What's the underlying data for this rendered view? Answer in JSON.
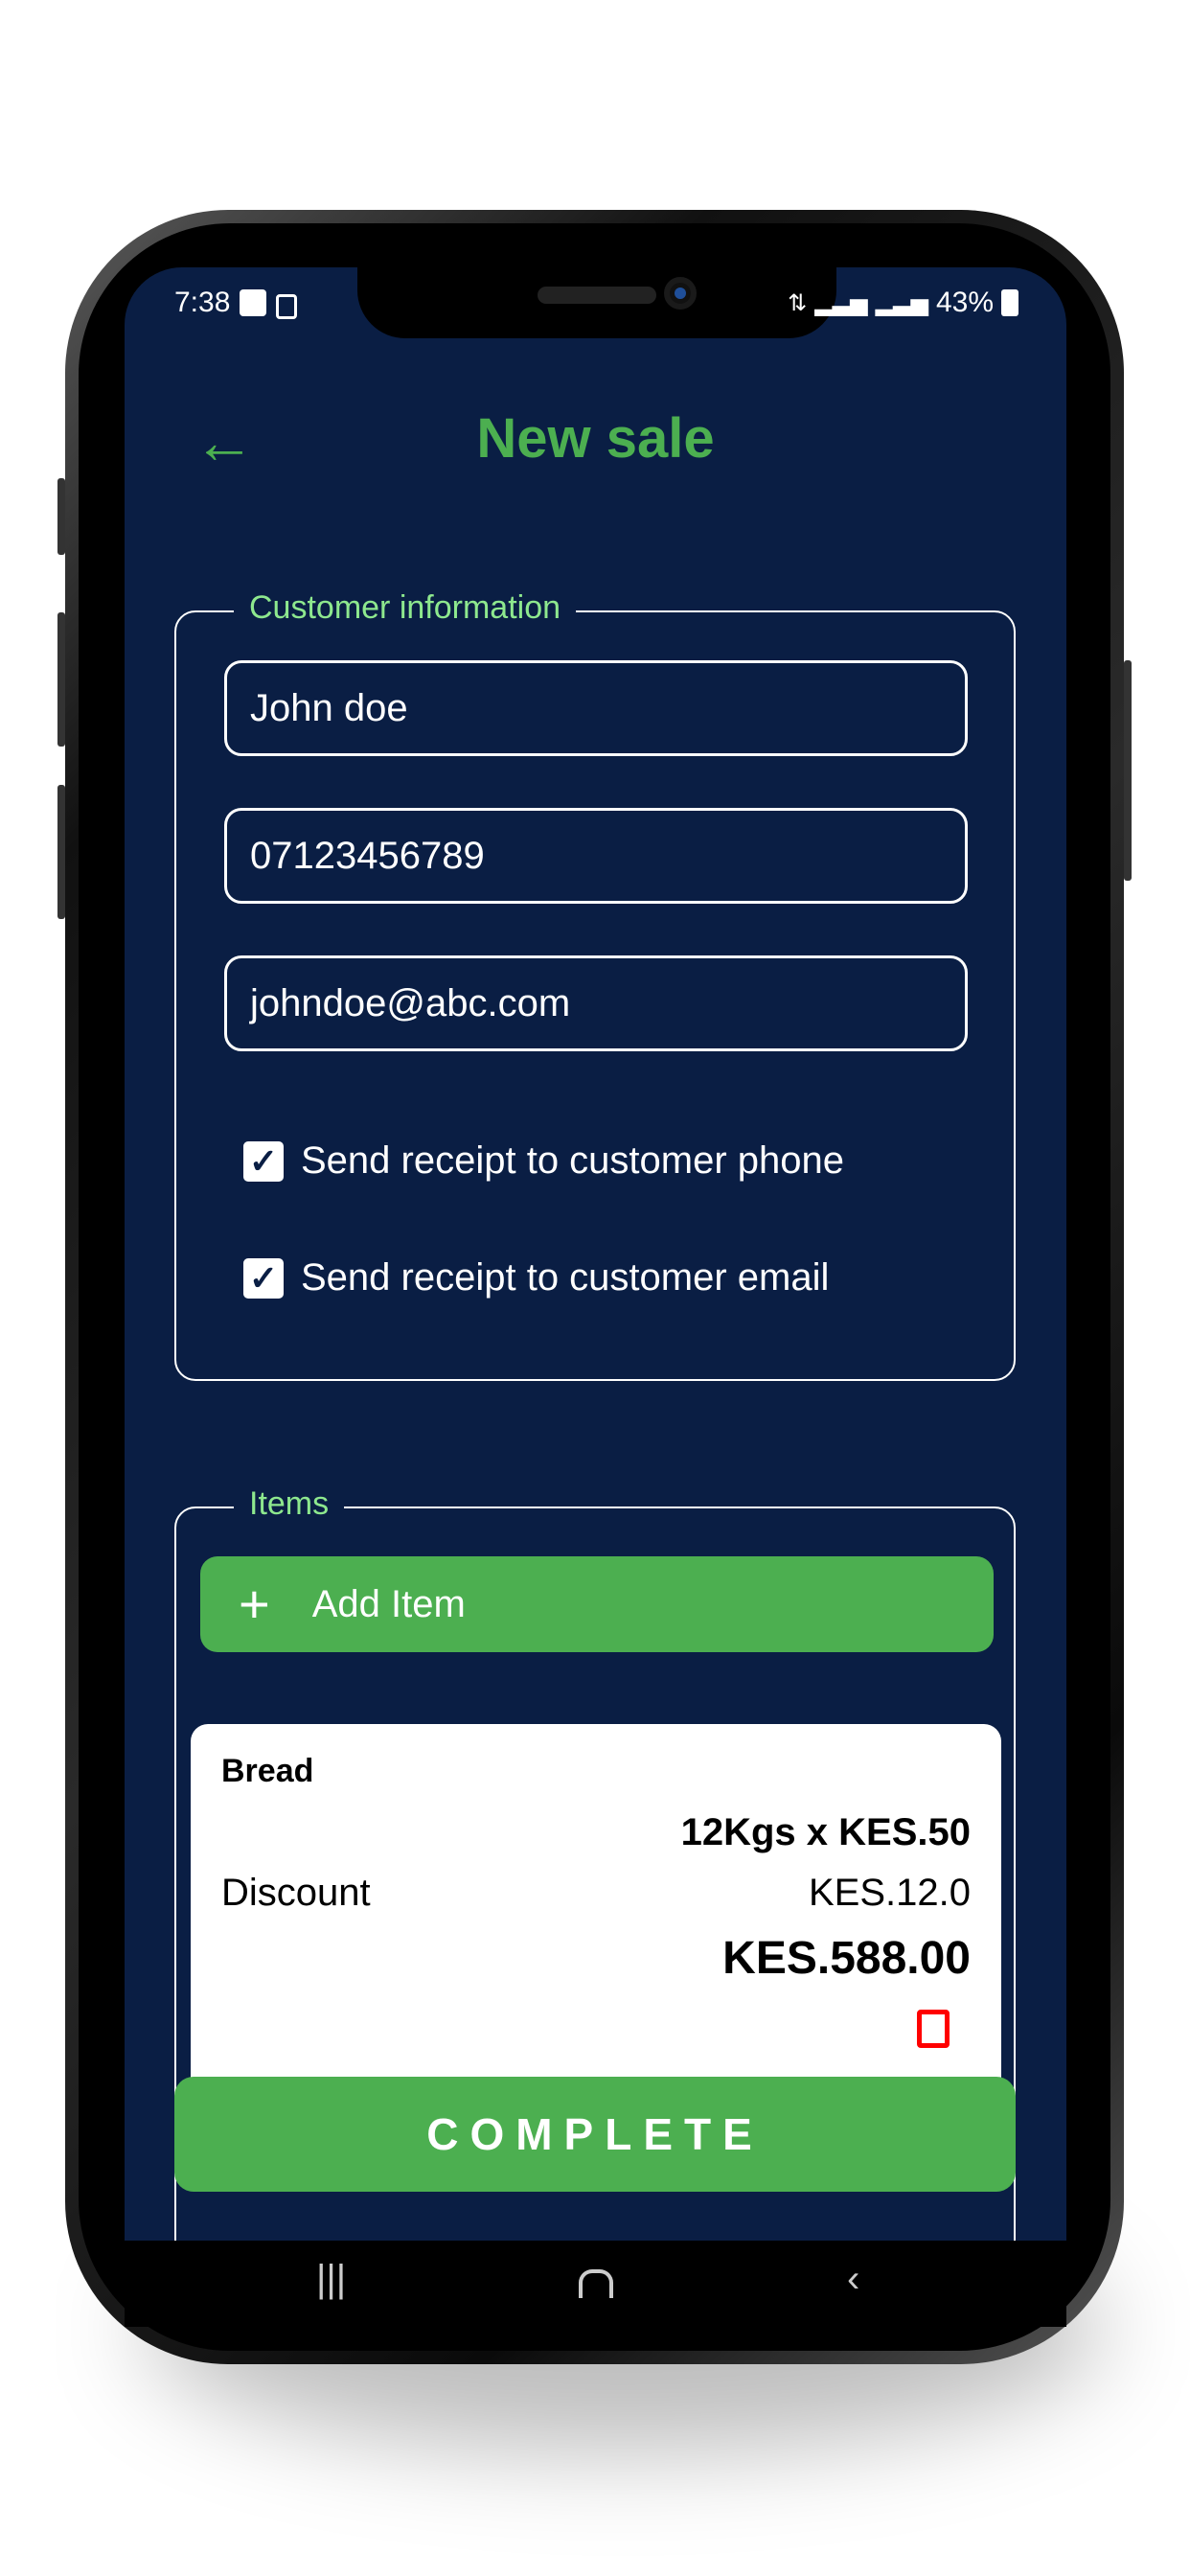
{
  "status_bar": {
    "time": "7:38",
    "battery": "43%",
    "icons": [
      "image-icon",
      "lock-icon",
      "wifi-icon",
      "signal-icon",
      "signal-icon",
      "battery-charging-icon"
    ]
  },
  "header": {
    "title": "New sale",
    "back_icon": "arrow-left-icon"
  },
  "customer": {
    "legend": "Customer information",
    "name": "John doe",
    "phone": "07123456789",
    "email": "johndoe@abc.com",
    "send_phone": {
      "label": "Send receipt to customer phone",
      "checked": true
    },
    "send_email": {
      "label": "Send receipt to customer email",
      "checked": true
    }
  },
  "items": {
    "legend": "Items",
    "add_label": "Add Item",
    "list": [
      {
        "name": "Bread",
        "qty_price": "12Kgs x KES.50",
        "discount_label": "Discount",
        "discount": "KES.12.0",
        "total": "KES.588.00"
      }
    ]
  },
  "complete_label": "COMPLETE",
  "colors": {
    "background": "#0a1e44",
    "accent": "#4caf50",
    "legend": "#8ee88e",
    "delete": "#ff0000"
  }
}
